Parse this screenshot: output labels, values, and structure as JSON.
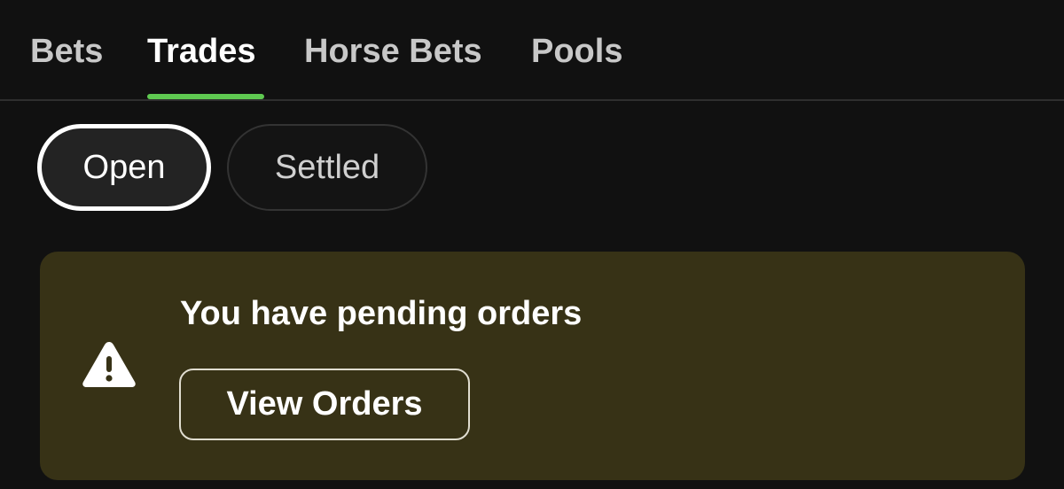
{
  "tabs": [
    {
      "label": "Bets",
      "active": false
    },
    {
      "label": "Trades",
      "active": true
    },
    {
      "label": "Horse Bets",
      "active": false
    },
    {
      "label": "Pools",
      "active": false
    }
  ],
  "accent_color": "#5fc951",
  "filters": {
    "open": {
      "label": "Open",
      "selected": true
    },
    "settled": {
      "label": "Settled",
      "selected": false
    }
  },
  "banner": {
    "icon": "warning-triangle-icon",
    "title": "You have pending orders",
    "button_label": "View Orders",
    "background": "#373216"
  }
}
